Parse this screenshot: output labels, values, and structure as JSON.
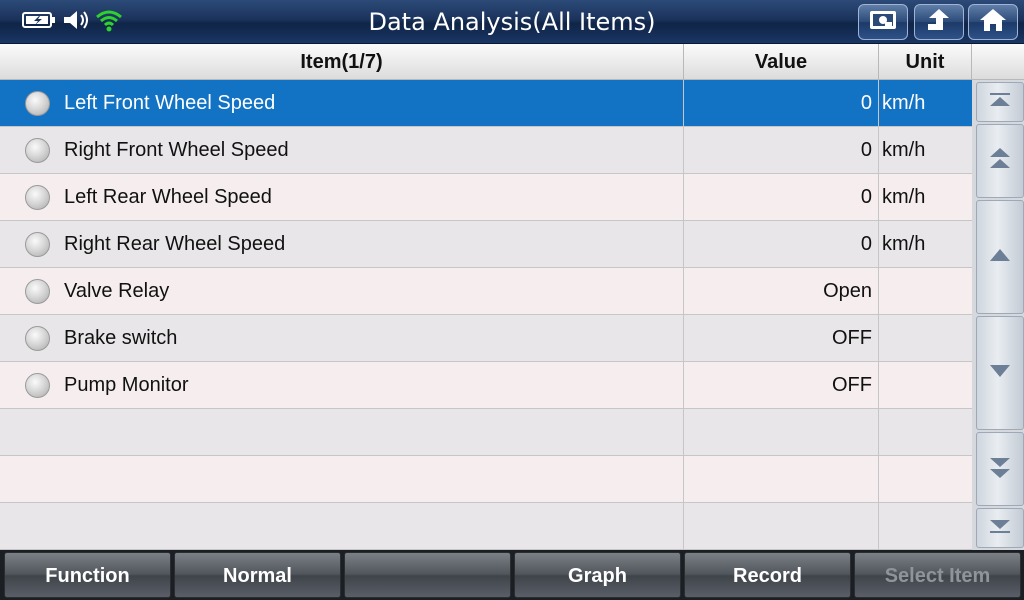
{
  "titlebar": {
    "title": "Data Analysis(All Items)",
    "status_icons": [
      "battery-icon",
      "speaker-icon",
      "wifi-icon"
    ],
    "buttons": [
      "screenshot-icon",
      "back-up-icon",
      "home-icon"
    ]
  },
  "table": {
    "headers": {
      "item": "Item(1/7)",
      "value": "Value",
      "unit": "Unit"
    },
    "rows": [
      {
        "item": "Left Front Wheel Speed",
        "value": "0",
        "unit": "km/h"
      },
      {
        "item": "Right Front Wheel Speed",
        "value": "0",
        "unit": "km/h"
      },
      {
        "item": "Left Rear Wheel Speed",
        "value": "0",
        "unit": "km/h"
      },
      {
        "item": "Right Rear Wheel Speed",
        "value": "0",
        "unit": "km/h"
      },
      {
        "item": "Valve Relay",
        "value": "Open",
        "unit": ""
      },
      {
        "item": "Brake switch",
        "value": "OFF",
        "unit": ""
      },
      {
        "item": "Pump Monitor",
        "value": "OFF",
        "unit": ""
      }
    ],
    "selected_row": 0
  },
  "scrollbar": {
    "buttons": [
      "scroll-top-icon",
      "page-up-icon",
      "line-up-icon",
      "line-down-icon",
      "page-down-icon",
      "scroll-bottom-icon"
    ]
  },
  "toolbar": {
    "function_label": "Function",
    "normal_label": "Normal",
    "empty_label": "",
    "graph_label": "Graph",
    "record_label": "Record",
    "select_item_label": "Select Item"
  },
  "colors": {
    "title_bar": "#1b335c",
    "selected_row": "#1272c4",
    "wifi": "#2fd12f"
  }
}
